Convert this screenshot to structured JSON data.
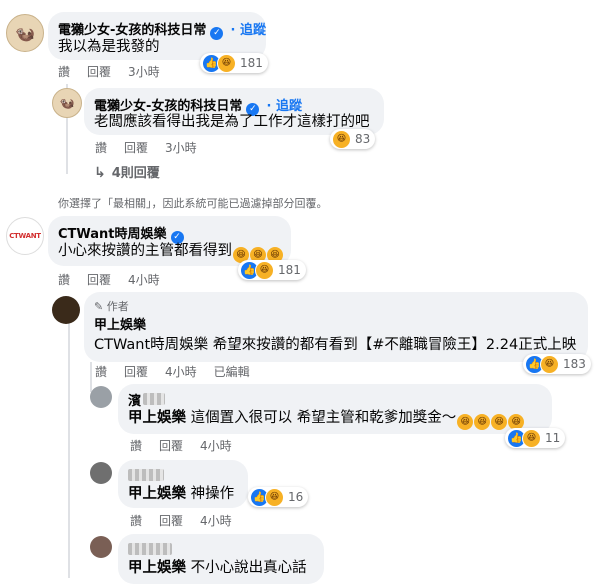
{
  "comment1": {
    "name": "電獺少女-女孩的科技日常",
    "follow": "· 追蹤",
    "text": "我以為是我發的",
    "like": "讚",
    "reply": "回覆",
    "time": "3小時",
    "reactions": "181"
  },
  "reply1": {
    "name": "電獺少女-女孩的科技日常",
    "follow": "· 追蹤",
    "text": "老闆應該看得出我是為了工作才這樣打的吧",
    "like": "讚",
    "reply": "回覆",
    "time": "3小時",
    "reactions": "83"
  },
  "more_replies": "4則回覆",
  "filter_notice": "你選擇了「最相關」，因此系統可能已過濾掉部分回覆。",
  "comment2": {
    "avatar_text": "CTWANT",
    "name": "CTWant時周娛樂",
    "text": "小心來按讚的主管都看得到",
    "like": "讚",
    "reply": "回覆",
    "time": "4小時",
    "reactions": "181"
  },
  "reply2": {
    "author_badge": "作者",
    "name": "甲上娛樂",
    "text": "CTWant時周娛樂 希望來按讚的都有看到【#不離職冒險王】2.24正式上映",
    "like": "讚",
    "reply": "回覆",
    "time": "4小時",
    "edited": "已編輯",
    "reactions": "183"
  },
  "reply3": {
    "name_fragment": "濱",
    "mention": "甲上娛樂",
    "text": "這個置入很可以 希望主管和乾爹加獎金～",
    "like": "讚",
    "reply": "回覆",
    "time": "4小時",
    "reactions": "11"
  },
  "reply4": {
    "mention": "甲上娛樂",
    "text": "神操作",
    "like": "讚",
    "reply": "回覆",
    "time": "4小時",
    "reactions": "16"
  },
  "reply5": {
    "mention": "甲上娛樂",
    "text": "不小心說出真心話"
  }
}
